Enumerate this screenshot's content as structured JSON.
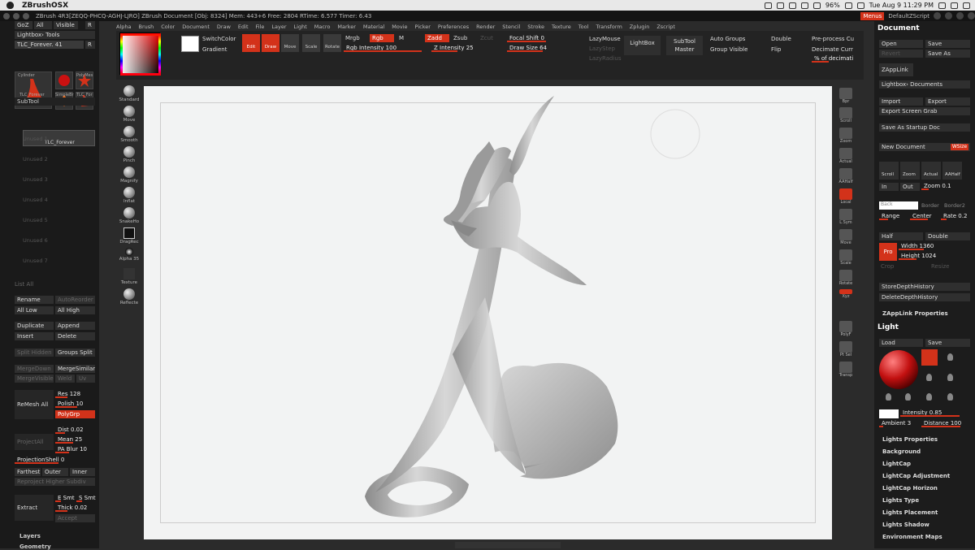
{
  "macbar": {
    "app": "ZBrushOSX",
    "battery": "96%",
    "datetime": "Tue Aug 9  11:29 PM"
  },
  "titlebar": {
    "text": "ZBrush 4R3[ZEQQ-PHCQ-AGHJ-LJRO]    ZBrush Document    [Obj: 8324]  Mem: 443+6  Free: 2804  RTime: 6.577  Timer: 6.43",
    "menus": "Menus",
    "script": "DefaultZScript"
  },
  "menu": [
    "Alpha",
    "Brush",
    "Color",
    "Document",
    "Draw",
    "Edit",
    "File",
    "Layer",
    "Light",
    "Macro",
    "Marker",
    "Material",
    "Movie",
    "Picker",
    "Preferences",
    "Render",
    "Stencil",
    "Stroke",
    "Texture",
    "Tool",
    "Transform",
    "Zplugin",
    "Zscript"
  ],
  "left": {
    "top_tabs": [
      "GoZ",
      "All",
      "Visible",
      "R"
    ],
    "lightbox_tools": "Lightbox› Tools",
    "tool_name": "TLC_Forever. 41",
    "tool_r": "R",
    "thumbs": [
      "TLC_Forever",
      "Cylinder",
      "PolyMes",
      "SimpleBr",
      "TLC_For"
    ],
    "subtool": "SubTool",
    "subtool_sel": "TLC_Forever",
    "subtools": [
      "Unused 1",
      "Unused 2",
      "Unused 3",
      "Unused 4",
      "Unused 5",
      "Unused 6",
      "Unused 7"
    ],
    "list_all": "List All",
    "rename": "Rename",
    "autoreorder": "AutoReorder",
    "all_low": "All Low",
    "all_high": "All High",
    "duplicate": "Duplicate",
    "append": "Append",
    "insert": "Insert",
    "delete": "Delete",
    "split_hidden": "Split Hidden",
    "groups_split": "Groups Split",
    "merge_down": "MergeDown",
    "merge_similar": "MergeSimilar",
    "merge_visible": "MergeVisible",
    "weld": "Weld",
    "uv": "Uv",
    "remesh_all": "ReMesh All",
    "res": "Res 128",
    "polish": "Polish 10",
    "polygrp": "PolyGrp",
    "project_all": "ProjectAll",
    "dist": "Dist 0.02",
    "mean": "Mean 25",
    "pa_blur": "PA Blur 10",
    "projection_shell": "ProjectionShell 0",
    "farthest": "Farthest",
    "outer": "Outer",
    "inner": "Inner",
    "reproject": "Reproject Higher Subdiv",
    "extract": "Extract",
    "e_smt": "E Smt",
    "s_smt": "S Smt",
    "thick": "Thick 0.02",
    "accept": "Accept",
    "layers": "Layers",
    "geometry": "Geometry"
  },
  "brushes": [
    "Standard",
    "Move",
    "Smooth",
    "Pinch",
    "Magnify",
    "Inflat",
    "SnakeHo",
    "DragRec",
    "Alpha 35",
    "Texture",
    "Reflecte"
  ],
  "shelf": {
    "switch_color": "SwitchColor",
    "gradient": "Gradient",
    "edit": "Edit",
    "draw": "Draw",
    "move": "Move",
    "scale": "Scale",
    "rotate": "Rotate",
    "mrgb": "Mrgb",
    "rgb": "Rgb",
    "m": "M",
    "rgb_intensity": "Rgb Intensity 100",
    "zadd": "Zadd",
    "zsub": "Zsub",
    "zcut": "Zcut",
    "z_intensity": "Z Intensity 25",
    "focal_shift": "Focal Shift 0",
    "draw_size": "Draw Size 64",
    "lazymouse": "LazyMouse",
    "lazystep": "LazyStep",
    "lazyradius": "LazyRadius",
    "lightbox": "LightBox",
    "subtool_master": "SubTool Master",
    "auto_groups": "Auto Groups",
    "group_visible": "Group Visible",
    "double": "Double",
    "flip": "Flip",
    "preprocess": "Pre-process Cu",
    "decimate": "Decimate Curr",
    "pct_decimate": "% of decimati"
  },
  "rightcol": [
    "Bpr",
    "Scroll",
    "Zoom",
    "Actual",
    "AAHalf",
    "Local",
    "L.Sym",
    "Move",
    "Scale",
    "Rotate",
    "Xyz",
    "PolyF",
    "Pt Sel",
    "Transp"
  ],
  "right": {
    "document": "Document",
    "open": "Open",
    "save": "Save",
    "revert": "Revert",
    "save_as": "Save As",
    "zapplink": "ZAppLink",
    "lightbox_docs": "Lightbox› Documents",
    "import": "Import",
    "export": "Export",
    "export_screen": "Export Screen Grab",
    "save_startup": "Save As Startup Doc",
    "new_document": "New Document",
    "wsize": "WSize",
    "scroll": "Scroll",
    "zoom": "Zoom",
    "actual": "Actual",
    "aahalf": "AAHalf",
    "in": "In",
    "out": "Out",
    "zoom_val": "Zoom 0.1",
    "back": "Back",
    "border": "Border",
    "border2": "Border2",
    "range": "Range",
    "center": "Center",
    "rate": "Rate 0.2",
    "half": "Half",
    "double": "Double",
    "pro": "Pro",
    "width": "Width 1360",
    "height": "Height 1024",
    "crop": "Crop",
    "resize": "Resize",
    "store_depth": "StoreDepthHistory",
    "delete_depth": "DeleteDepthHistory",
    "zapplink_props": "ZAppLink Properties",
    "light": "Light",
    "load": "Load",
    "light_save": "Save",
    "intensity": "Intensity 0.85",
    "ambient": "Ambient 3",
    "distance": "Distance 100",
    "light_items": [
      "Lights Properties",
      "Background",
      "LightCap",
      "LightCap Adjustment",
      "LightCap Horizon",
      "Lights Type",
      "Lights Placement",
      "Lights Shadow",
      "Environment Maps"
    ]
  }
}
